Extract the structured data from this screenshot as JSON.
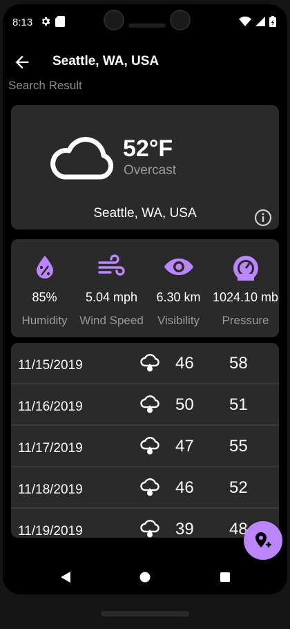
{
  "status_bar": {
    "time": "8:13",
    "icons_left": [
      "gear-icon",
      "sim-card-icon"
    ],
    "icons_right": [
      "wifi-icon",
      "signal-icon",
      "battery-icon"
    ]
  },
  "app_bar": {
    "title": "Seattle, WA, USA",
    "back_icon": "arrow-left-icon"
  },
  "search_label": "Search Result",
  "current": {
    "temperature": "52°F",
    "condition": "Overcast",
    "location": "Seattle, WA, USA",
    "icon": "cloud-icon",
    "info_icon": "info-icon"
  },
  "stats": [
    {
      "icon": "water-percent-icon",
      "value": "85%",
      "label": "Humidity"
    },
    {
      "icon": "wind-icon",
      "value": "5.04 mph",
      "label": "Wind Speed"
    },
    {
      "icon": "eye-icon",
      "value": "6.30 km",
      "label": "Visibility"
    },
    {
      "icon": "gauge-icon",
      "value": "1024.10 mb",
      "label": "Pressure"
    }
  ],
  "forecast": [
    {
      "date": "11/15/2019",
      "icon": "cloud-rain-icon",
      "low": "46",
      "high": "58"
    },
    {
      "date": "11/16/2019",
      "icon": "cloud-rain-icon",
      "low": "50",
      "high": "51"
    },
    {
      "date": "11/17/2019",
      "icon": "cloud-rain-icon",
      "low": "47",
      "high": "55"
    },
    {
      "date": "11/18/2019",
      "icon": "cloud-rain-icon",
      "low": "46",
      "high": "52"
    },
    {
      "date": "11/19/2019",
      "icon": "cloud-rain-icon",
      "low": "39",
      "high": "48"
    }
  ],
  "fab": {
    "icon": "add-location-icon"
  },
  "nav": {
    "icons": [
      "nav-back-icon",
      "nav-home-icon",
      "nav-recents-icon"
    ]
  },
  "colors": {
    "accent": "#bb86fc",
    "background": "#000000",
    "card": "#2a2a2a",
    "text_primary": "#ffffff",
    "text_secondary": "#9a9a9a"
  }
}
